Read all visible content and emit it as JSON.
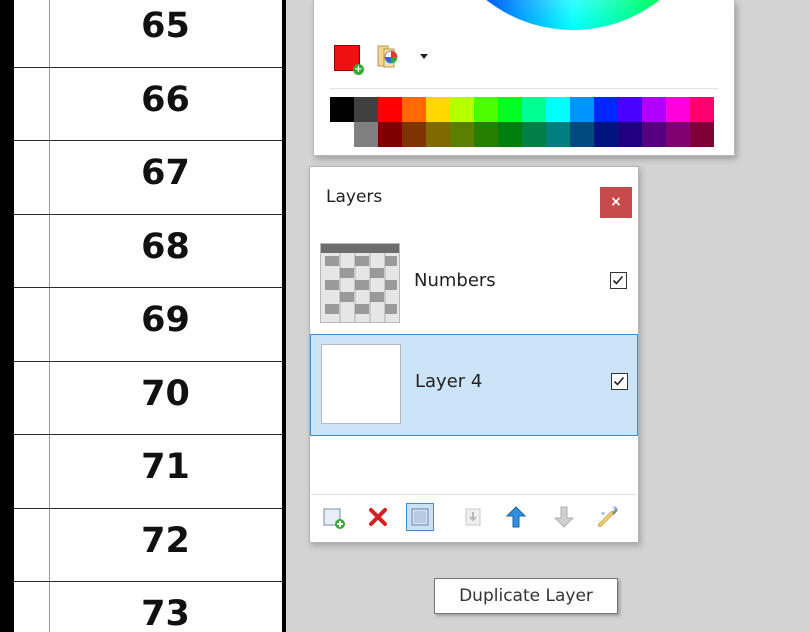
{
  "canvas": {
    "row_numbers": [
      "65",
      "66",
      "67",
      "68",
      "69",
      "70",
      "71",
      "72",
      "73"
    ]
  },
  "colors_window": {
    "primary_color": "#e11111",
    "palette_top": [
      "#000000",
      "#404040",
      "#ff0000",
      "#ff6a00",
      "#ffd800",
      "#b6ff00",
      "#4cff00",
      "#00ff21",
      "#00ff90",
      "#00ffff",
      "#0094ff",
      "#0026ff",
      "#4800ff",
      "#b200ff",
      "#ff00dc",
      "#ff006e"
    ],
    "palette_bottom": [
      "#ffffff",
      "#808080",
      "#7f0000",
      "#7f3300",
      "#7f6a00",
      "#5b7f00",
      "#267f00",
      "#007f0e",
      "#007f46",
      "#007f7f",
      "#004a7f",
      "#00137f",
      "#21007f",
      "#57007f",
      "#7f006e",
      "#7f0037"
    ]
  },
  "layers_window": {
    "title": "Layers",
    "close_label": "×",
    "layers": [
      {
        "name": "Numbers",
        "visible": true,
        "selected": false
      },
      {
        "name": "Layer 4",
        "visible": true,
        "selected": true
      }
    ],
    "toolbar": {
      "add_layer_icon": "add-layer-icon",
      "delete_layer_icon": "delete-layer-icon",
      "duplicate_layer_icon": "duplicate-layer-icon",
      "merge_down_icon": "merge-layer-down-icon",
      "move_up_icon": "move-layer-up-icon",
      "move_down_icon": "move-layer-down-icon",
      "properties_icon": "layer-properties-icon"
    }
  },
  "tooltip": {
    "text": "Duplicate Layer"
  }
}
